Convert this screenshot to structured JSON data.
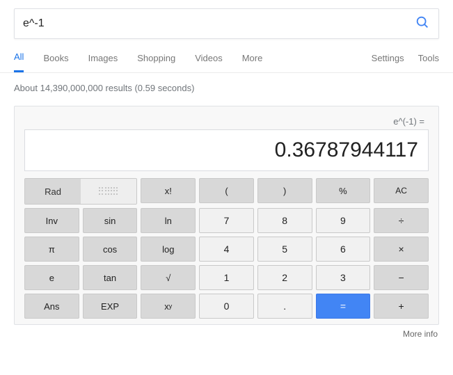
{
  "search": {
    "query": "e^-1"
  },
  "tabs": {
    "all": "All",
    "books": "Books",
    "images": "Images",
    "shopping": "Shopping",
    "videos": "Videos",
    "more": "More",
    "settings": "Settings",
    "tools": "Tools"
  },
  "resultStats": "About 14,390,000,000 results (0.59 seconds)",
  "calc": {
    "expression": "e^(-1) =",
    "result": "0.36787944117",
    "rad": "Rad",
    "buttons": {
      "factorial": "x!",
      "lparen": "(",
      "rparen": ")",
      "percent": "%",
      "ac": "AC",
      "inv": "Inv",
      "sin": "sin",
      "ln": "ln",
      "n7": "7",
      "n8": "8",
      "n9": "9",
      "div": "÷",
      "pi": "π",
      "cos": "cos",
      "log": "log",
      "n4": "4",
      "n5": "5",
      "n6": "6",
      "mul": "×",
      "e": "e",
      "tan": "tan",
      "sqrt": "√",
      "n1": "1",
      "n2": "2",
      "n3": "3",
      "sub": "−",
      "ans": "Ans",
      "exp": "EXP",
      "xy_base": "x",
      "xy_exp": "y",
      "n0": "0",
      "dot": ".",
      "eq": "=",
      "add": "+"
    }
  },
  "moreInfo": "More info"
}
